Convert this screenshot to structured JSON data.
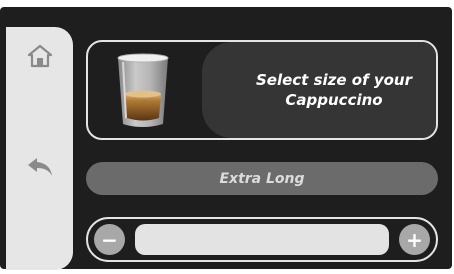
{
  "sidebar": {
    "home_icon": "home-icon",
    "back_icon": "back-arrow-icon"
  },
  "product": {
    "title_line1": "Select size of your",
    "title_line2": "Cappuccino",
    "image": "cappuccino-glass"
  },
  "size": {
    "selected": "Extra Long"
  },
  "stepper": {
    "minus_label": "−",
    "plus_label": "+",
    "level": 1.0
  },
  "colors": {
    "background": "#1e1e1e",
    "sidebar": "#e6e6e6",
    "card_text_bg": "#353535",
    "pill": "#6b6b6b",
    "step_button": "#a8a8a8",
    "track": "#e3e3e3"
  }
}
